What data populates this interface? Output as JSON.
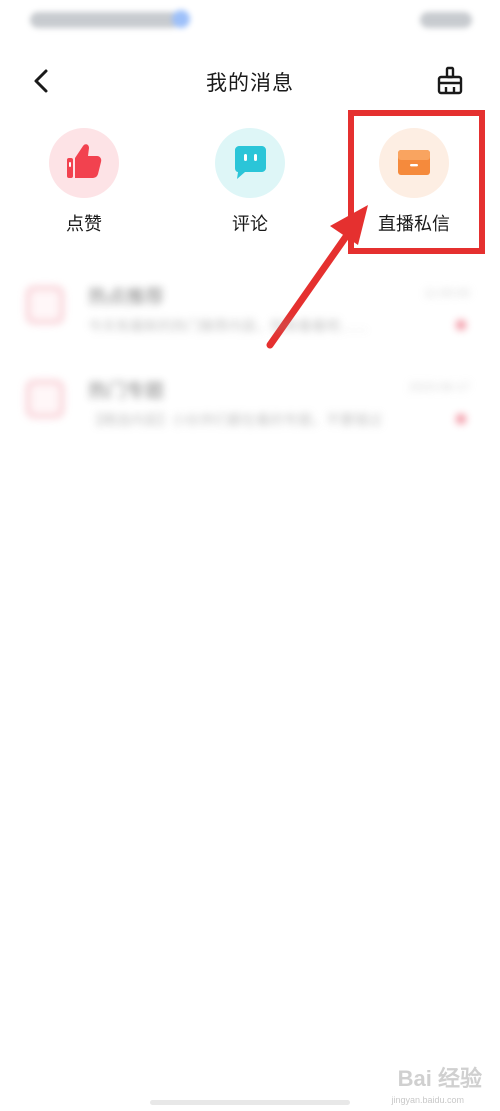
{
  "header": {
    "title": "我的消息"
  },
  "categories": [
    {
      "label": "点赞",
      "icon": "thumbs-up-icon",
      "color": "#f2424f"
    },
    {
      "label": "评论",
      "icon": "chat-bubble-icon",
      "color": "#2bc5d8"
    },
    {
      "label": "直播私信",
      "icon": "mail-icon",
      "color": "#f58a3c"
    }
  ],
  "messages": [
    {
      "title": "热点推荐",
      "time": "11:00:00",
      "preview": "今天有最新的热门推荐内容，快来看看吧……"
    },
    {
      "title": "热门专题",
      "time": "2023-06-17",
      "preview": "【精选内容】小伙伴们都在看的专题，不要错过"
    }
  ],
  "annotation": {
    "highlight_color": "#e5302f"
  },
  "watermark": {
    "text": "Bai 经验",
    "url": "jingyan.baidu.com"
  }
}
